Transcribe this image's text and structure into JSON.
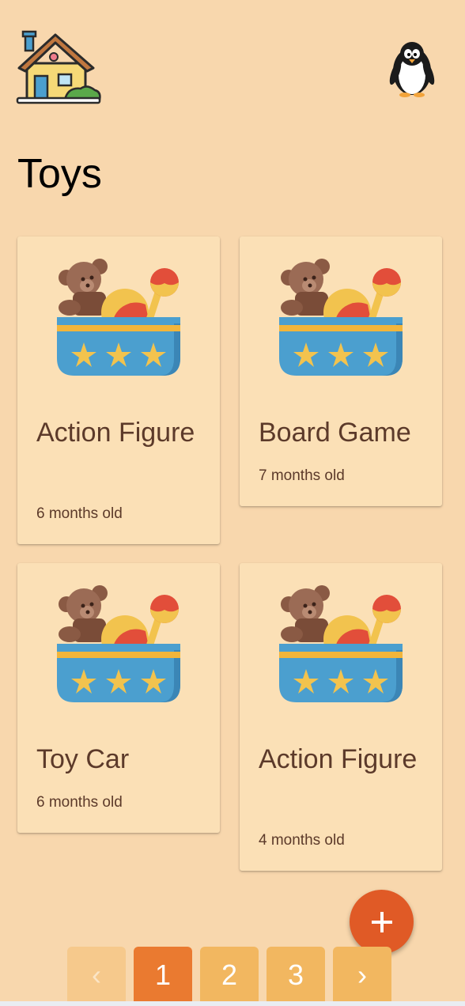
{
  "header": {
    "logo_icon": "house-icon",
    "avatar_icon": "penguin-avatar-icon"
  },
  "page": {
    "title": "Toys"
  },
  "cards": [
    {
      "name": "Action Figure",
      "age": "6 months old",
      "icon": "toy-box-icon"
    },
    {
      "name": "Board Game",
      "age": "7 months old",
      "icon": "toy-box-icon"
    },
    {
      "name": "Toy Car",
      "age": "6 months old",
      "icon": "toy-box-icon"
    },
    {
      "name": "Action Figure",
      "age": "4 months old",
      "icon": "toy-box-icon"
    }
  ],
  "fab": {
    "label": "+",
    "icon": "plus-icon"
  },
  "pagination": {
    "prev": "‹",
    "pages": [
      "1",
      "2",
      "3"
    ],
    "next": "›",
    "current": "1"
  },
  "colors": {
    "background": "#f8d7ad",
    "card": "#fbe0b6",
    "text": "#5c3a2a",
    "fab": "#e05a26",
    "page_active": "#ea7a30",
    "page": "#f2b760"
  }
}
